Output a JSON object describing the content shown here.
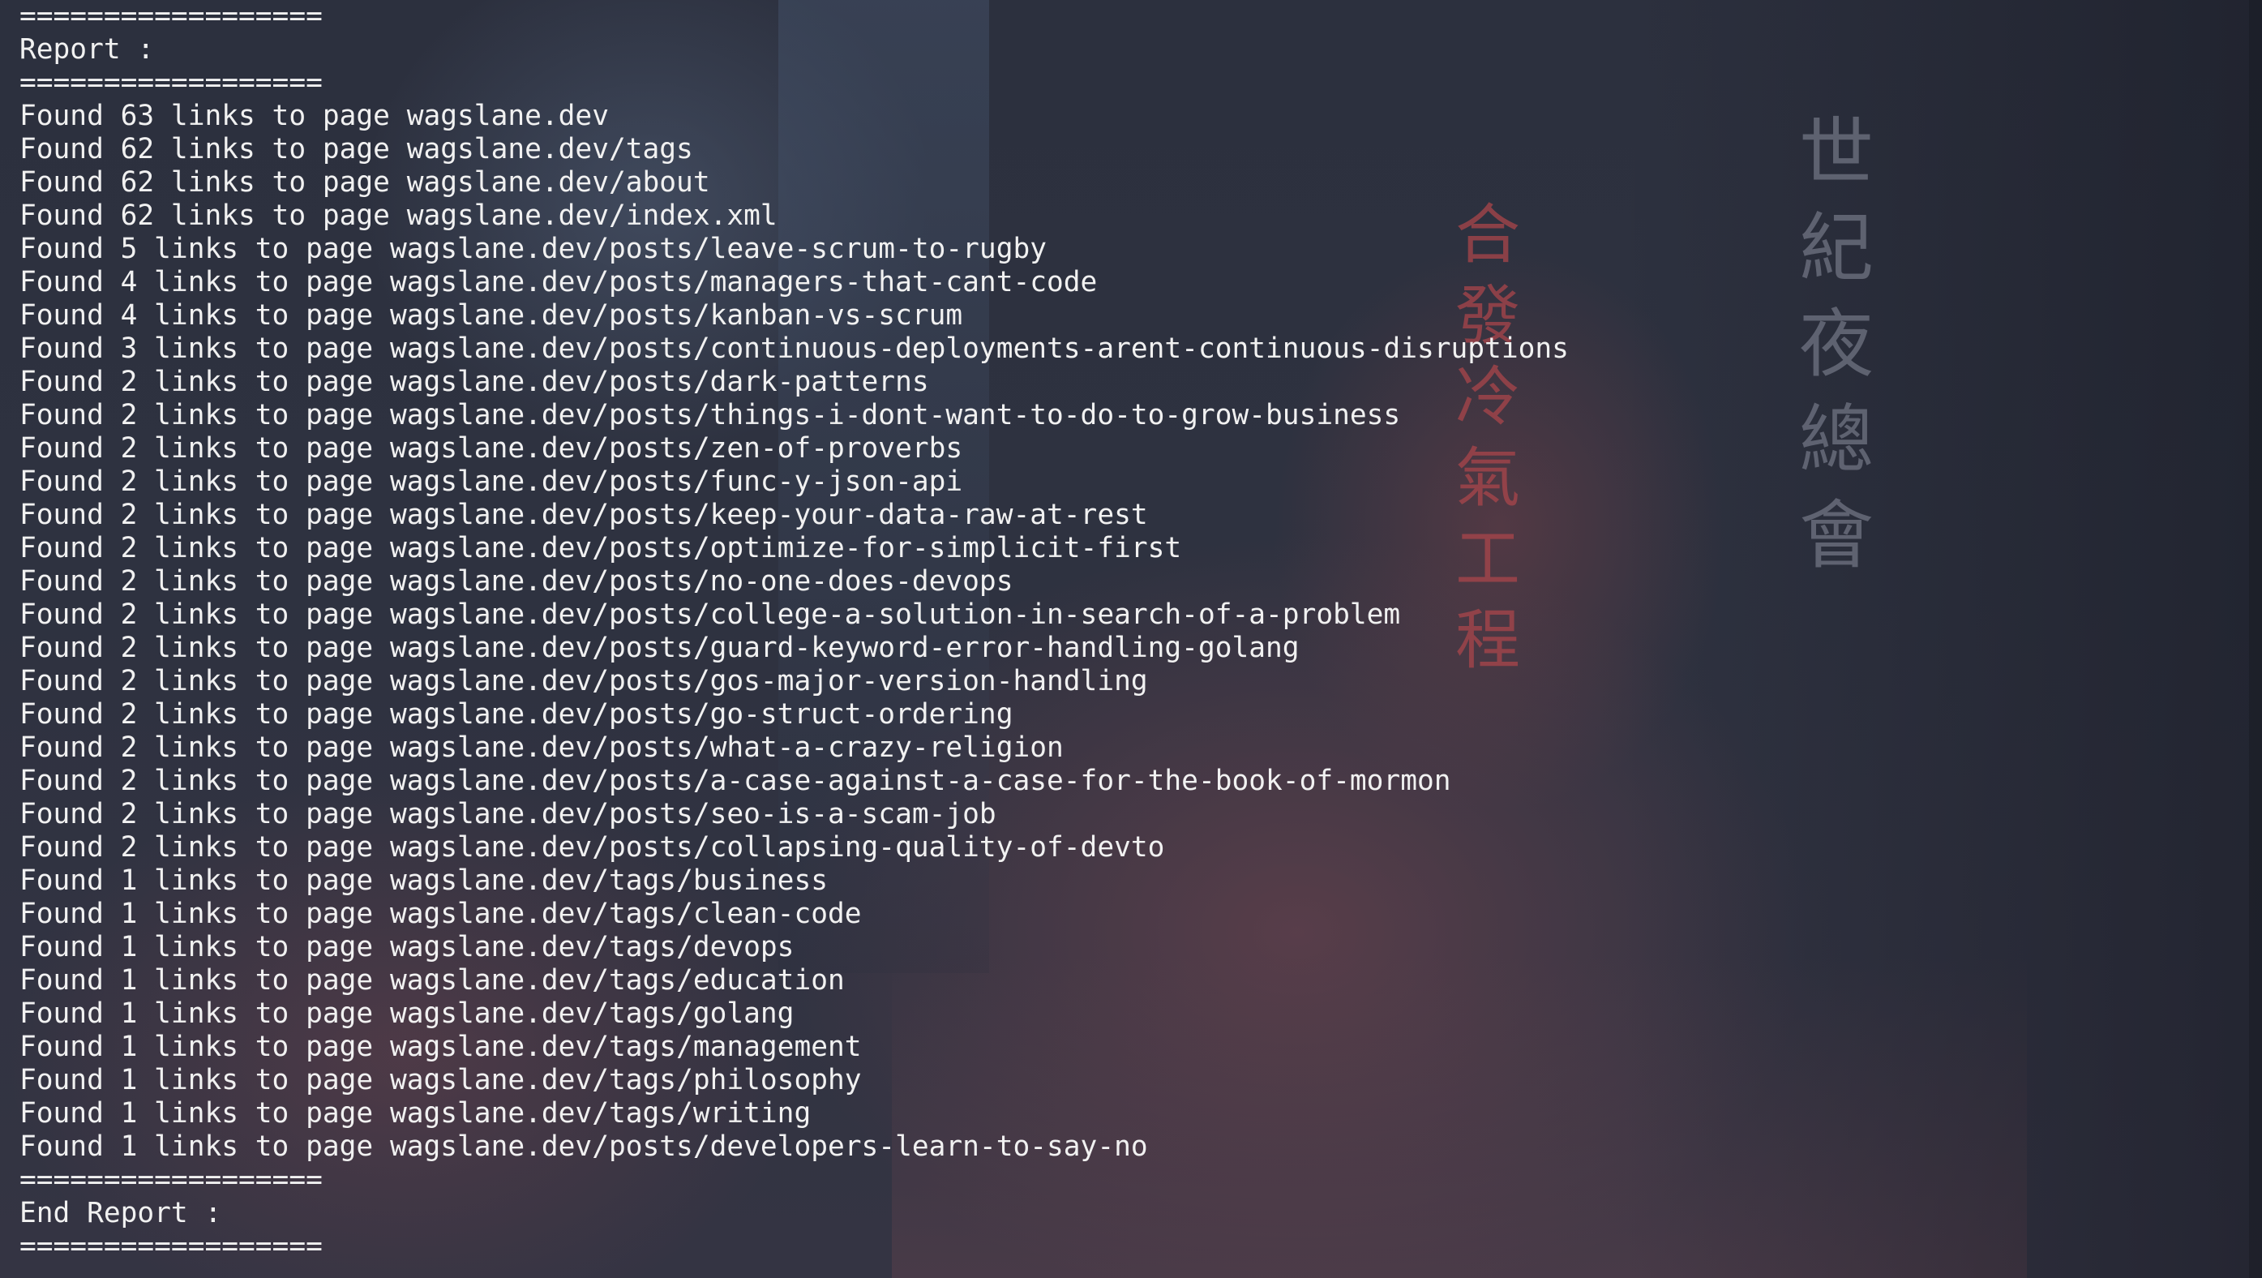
{
  "terminal": {
    "lines": [
      "==================",
      "Report :",
      "==================",
      "Found 63 links to page wagslane.dev",
      "Found 62 links to page wagslane.dev/tags",
      "Found 62 links to page wagslane.dev/about",
      "Found 62 links to page wagslane.dev/index.xml",
      "Found 5 links to page wagslane.dev/posts/leave-scrum-to-rugby",
      "Found 4 links to page wagslane.dev/posts/managers-that-cant-code",
      "Found 4 links to page wagslane.dev/posts/kanban-vs-scrum",
      "Found 3 links to page wagslane.dev/posts/continuous-deployments-arent-continuous-disruptions",
      "Found 2 links to page wagslane.dev/posts/dark-patterns",
      "Found 2 links to page wagslane.dev/posts/things-i-dont-want-to-do-to-grow-business",
      "Found 2 links to page wagslane.dev/posts/zen-of-proverbs",
      "Found 2 links to page wagslane.dev/posts/func-y-json-api",
      "Found 2 links to page wagslane.dev/posts/keep-your-data-raw-at-rest",
      "Found 2 links to page wagslane.dev/posts/optimize-for-simplicit-first",
      "Found 2 links to page wagslane.dev/posts/no-one-does-devops",
      "Found 2 links to page wagslane.dev/posts/college-a-solution-in-search-of-a-problem",
      "Found 2 links to page wagslane.dev/posts/guard-keyword-error-handling-golang",
      "Found 2 links to page wagslane.dev/posts/gos-major-version-handling",
      "Found 2 links to page wagslane.dev/posts/go-struct-ordering",
      "Found 2 links to page wagslane.dev/posts/what-a-crazy-religion",
      "Found 2 links to page wagslane.dev/posts/a-case-against-a-case-for-the-book-of-mormon",
      "Found 2 links to page wagslane.dev/posts/seo-is-a-scam-job",
      "Found 2 links to page wagslane.dev/posts/collapsing-quality-of-devto",
      "Found 1 links to page wagslane.dev/tags/business",
      "Found 1 links to page wagslane.dev/tags/clean-code",
      "Found 1 links to page wagslane.dev/tags/devops",
      "Found 1 links to page wagslane.dev/tags/education",
      "Found 1 links to page wagslane.dev/tags/golang",
      "Found 1 links to page wagslane.dev/tags/management",
      "Found 1 links to page wagslane.dev/tags/philosophy",
      "Found 1 links to page wagslane.dev/tags/writing",
      "Found 1 links to page wagslane.dev/posts/developers-learn-to-say-no",
      "==================",
      "End Report :",
      "=================="
    ]
  },
  "background": {
    "sign_vertical": "世紀夜總會",
    "sign_red": "合發冷氣工程",
    "colors": {
      "terminal_bg": "#2b2f3d",
      "text": "#f1f1f1",
      "neon_red": "#aa464b"
    }
  }
}
